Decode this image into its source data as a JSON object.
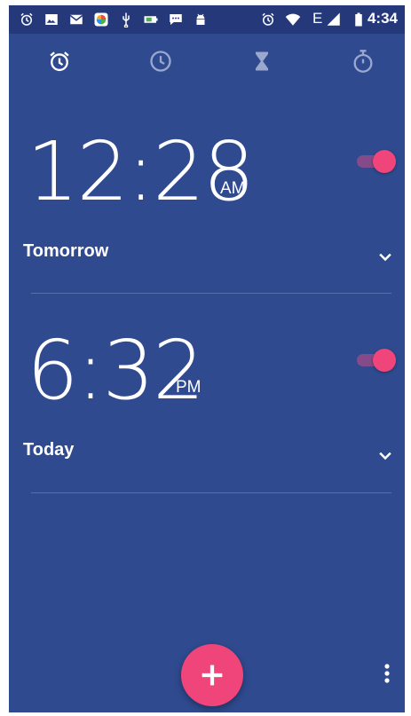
{
  "status_bar": {
    "time": "4:34",
    "network_label": "E",
    "left_icons": [
      "alarm-icon",
      "image-icon",
      "mail-icon",
      "app-icon",
      "usb-icon",
      "battery-saver-icon",
      "message-icon",
      "android-icon"
    ],
    "right_icons": [
      "alarm-icon",
      "wifi-icon",
      "signal-icon",
      "battery-icon"
    ]
  },
  "tabs": [
    {
      "name": "alarm",
      "icon": "alarm-icon",
      "active": true
    },
    {
      "name": "clock",
      "icon": "clock-icon",
      "active": false
    },
    {
      "name": "timer",
      "icon": "hourglass-icon",
      "active": false
    },
    {
      "name": "stopwatch",
      "icon": "stopwatch-icon",
      "active": false
    }
  ],
  "alarms": [
    {
      "time": "12:28",
      "ampm": "AM",
      "day": "Tomorrow",
      "enabled": true
    },
    {
      "time": "6:32",
      "ampm": "PM",
      "day": "Today",
      "enabled": true
    }
  ],
  "fab": {
    "icon": "plus-icon"
  },
  "menu": {
    "icon": "more-vert-icon"
  },
  "colors": {
    "background": "#2f4a8f",
    "status_bar": "#25397a",
    "accent": "#f0457a"
  }
}
